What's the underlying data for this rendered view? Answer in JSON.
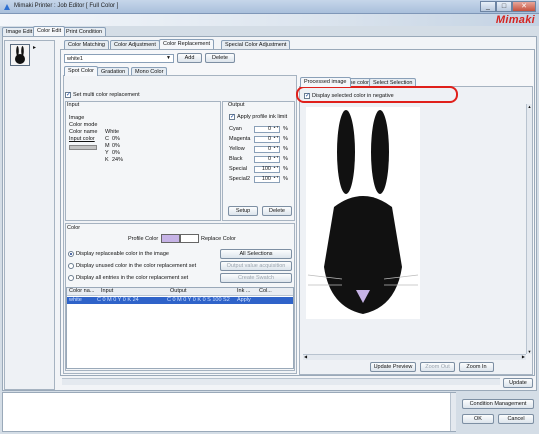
{
  "window": {
    "title": "Mimaki Printer : Job Editor [ Full Color ]",
    "brand": "Mimaki",
    "controls": {
      "minimize": "_",
      "maximize": "□",
      "close": "✕"
    }
  },
  "main_tabs": [
    "Image Edit",
    "Color Edit",
    "Print Condition"
  ],
  "sub_tabs": [
    "Color Matching",
    "Color Adjustment",
    "Color Replacement",
    "Special Color Adjustment"
  ],
  "profile": {
    "selected": "white1",
    "add_label": "Add",
    "delete_label": "Delete"
  },
  "mode_tabs": [
    "Spot Color",
    "Gradation",
    "Mono Color"
  ],
  "set_multi": "Set multi color replacement",
  "input": {
    "title": "Input",
    "image_label": "Image",
    "color_mode_label": "Color mode",
    "color_name_label": "Color name",
    "color_name_value": "White",
    "input_color_label": "Input color",
    "values": [
      {
        "ch": "C",
        "val": "0%"
      },
      {
        "ch": "M",
        "val": "0%"
      },
      {
        "ch": "Y",
        "val": "0%"
      },
      {
        "ch": "K",
        "val": "24%"
      }
    ]
  },
  "output": {
    "title": "Output",
    "apply_limit": "Apply profile ink limit",
    "rows": [
      {
        "label": "Cyan",
        "value": "0",
        "unit": "%"
      },
      {
        "label": "Magenta",
        "value": "0",
        "unit": "%"
      },
      {
        "label": "Yellow",
        "value": "0",
        "unit": "%"
      },
      {
        "label": "Black",
        "value": "0",
        "unit": "%"
      },
      {
        "label": "Special",
        "value": "100",
        "unit": "%"
      },
      {
        "label": "Special2",
        "value": "100",
        "unit": "%"
      }
    ],
    "setup_label": "Setup",
    "delete_label": "Delete"
  },
  "color": {
    "title": "Color",
    "profile_color_label": "Profile Color",
    "replace_color_label": "Replace Color",
    "profile_swatch": "#c6b3e6",
    "replace_swatch": "#ffffff",
    "options": [
      "Display replaceable color in the image",
      "Display unused color in the color replacement set",
      "Display all entries in the color replacement set"
    ],
    "all_selections": "All Selections",
    "output_value_acquisition": "Output value acquisition",
    "create_swatch": "Create Swatch"
  },
  "list": {
    "headers": [
      "Color na...",
      "Input",
      "Output",
      "Ink ...",
      "Col..."
    ],
    "row": [
      "white",
      "C 0 M 0 Y 0 K 24",
      "C 0 M 0 Y 0 K 0 S 100 S2",
      "Apply",
      ""
    ]
  },
  "preview": {
    "tabs": [
      "Processed image",
      "Base color",
      "Select Selection"
    ],
    "negative_label": "Display selected color in negative",
    "update_preview": "Update Preview",
    "zoom_out": "Zoom Out",
    "zoom_in": "Zoom In"
  },
  "update_label": "Update",
  "bottom": {
    "condition_management": "Condition Management",
    "ok": "OK",
    "cancel": "Cancel"
  },
  "colors": {
    "accent_red": "#e0201b",
    "selection_blue": "#2f63c9",
    "brand_red": "#d6231f"
  }
}
